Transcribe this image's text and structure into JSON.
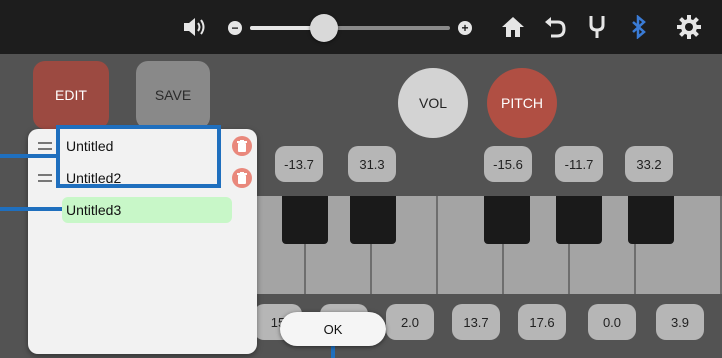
{
  "topbar": {
    "icons": [
      "speaker-icon",
      "home-icon",
      "undo-icon",
      "tuning-fork-icon",
      "bluetooth-icon",
      "gear-icon"
    ],
    "volume_level": 0.37,
    "bluetooth_color": "#3a7bd5"
  },
  "controls": {
    "edit_label": "EDIT",
    "save_label": "SAVE",
    "vol_label": "VOL",
    "pitch_label": "PITCH"
  },
  "top_chips": [
    "-13.7",
    "31.3",
    "-15.6",
    "-11.7",
    "33.2"
  ],
  "bottom_chips": [
    "15",
    "",
    "2.0",
    "13.7",
    "17.6",
    "0.0",
    "3.9"
  ],
  "list": {
    "items": [
      {
        "label": "Untitled"
      },
      {
        "label": "Untitled2"
      }
    ],
    "selected": {
      "label": "Untitled3"
    }
  },
  "ok_label": "OK",
  "colors": {
    "accent_red": "#b04f43",
    "selection_green": "#c8f7c8",
    "callout_blue": "#1f6fbe"
  }
}
